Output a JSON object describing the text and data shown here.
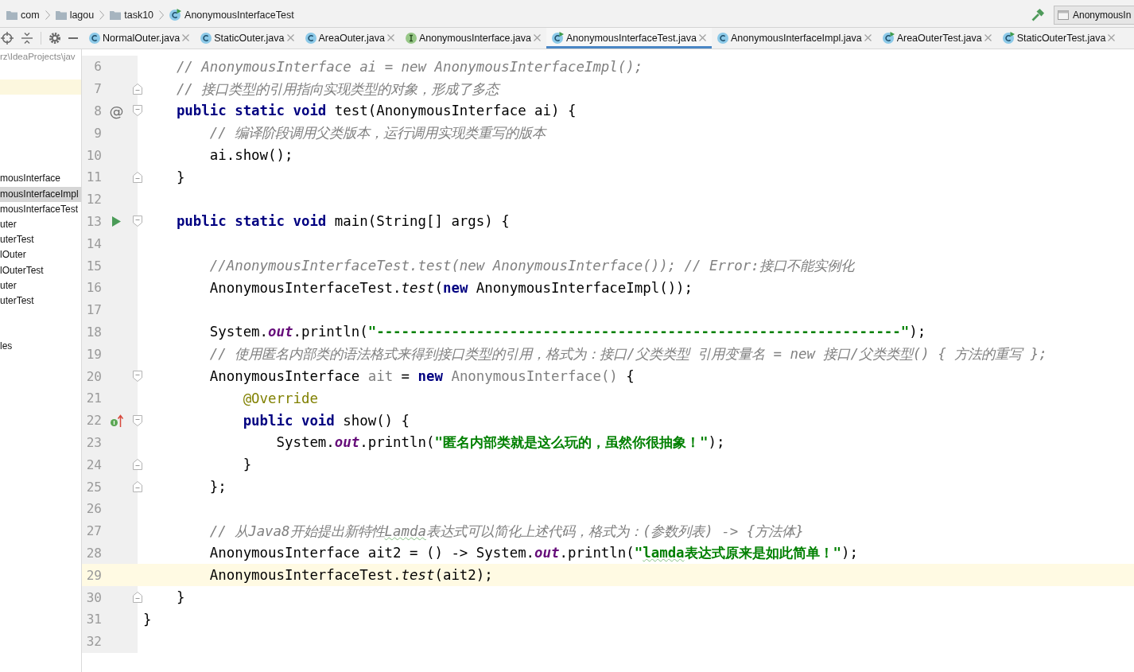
{
  "breadcrumbs": [
    {
      "label": "com",
      "kind": "folder"
    },
    {
      "label": "lagou",
      "kind": "folder"
    },
    {
      "label": "task10",
      "kind": "folder"
    },
    {
      "label": "AnonymousInterfaceTest",
      "kind": "runnable-class"
    }
  ],
  "run_config": {
    "label": "AnonymousIn"
  },
  "tabs": [
    {
      "label": "NormalOuter.java",
      "kind": "class",
      "selected": false
    },
    {
      "label": "StaticOuter.java",
      "kind": "class",
      "selected": false
    },
    {
      "label": "AreaOuter.java",
      "kind": "class",
      "selected": false
    },
    {
      "label": "AnonymousInterface.java",
      "kind": "interface",
      "selected": false
    },
    {
      "label": "AnonymousInterfaceTest.java",
      "kind": "runnable-class",
      "selected": true
    },
    {
      "label": "AnonymousInterfaceImpl.java",
      "kind": "class",
      "selected": false
    },
    {
      "label": "AreaOuterTest.java",
      "kind": "runnable-class",
      "selected": false
    },
    {
      "label": "StaticOuterTest.java",
      "kind": "runnable-class",
      "selected": false
    }
  ],
  "project_tree": {
    "path": "rz\\IdeaProjects\\jav",
    "items": [
      {
        "label": "mousInterface",
        "selected": false
      },
      {
        "label": "mousInterfaceImpl",
        "selected": true
      },
      {
        "label": "mousInterfaceTest",
        "selected": false
      },
      {
        "label": "uter",
        "selected": false
      },
      {
        "label": "uterTest",
        "selected": false
      },
      {
        "label": "lOuter",
        "selected": false
      },
      {
        "label": "lOuterTest",
        "selected": false
      },
      {
        "label": "uter",
        "selected": false
      },
      {
        "label": "uterTest",
        "selected": false
      },
      {
        "label": "les",
        "selected": false
      }
    ]
  },
  "editor": {
    "lines": [
      {
        "number": "6",
        "current": false,
        "tokens": [
          {
            "kind": "comment",
            "text": "    // AnonymousInterface ai = new AnonymousInterfaceImpl();"
          }
        ]
      },
      {
        "number": "7",
        "current": false,
        "fold": {
          "kind": "end"
        },
        "tokens": [
          {
            "kind": "comment",
            "text": "    // 接口类型的引用指向实现类型的对象，形成了多态"
          }
        ]
      },
      {
        "number": "8",
        "current": false,
        "fold": {
          "kind": "start"
        },
        "marker": {
          "kind": "symbol",
          "text": "@"
        },
        "tokens": [
          {
            "kind": "keyword",
            "text": "    public static void"
          },
          {
            "kind": "plain",
            "text": " test(AnonymousInterface ai) {"
          }
        ]
      },
      {
        "number": "9",
        "current": false,
        "tokens": [
          {
            "kind": "comment",
            "text": "        // 编译阶段调用父类版本，运行调用实现类重写的版本"
          }
        ]
      },
      {
        "number": "10",
        "current": false,
        "tokens": [
          {
            "kind": "plain",
            "text": "        ai.show();"
          }
        ]
      },
      {
        "number": "11",
        "current": false,
        "fold": {
          "kind": "end"
        },
        "tokens": [
          {
            "kind": "plain",
            "text": "    }"
          }
        ]
      },
      {
        "number": "12",
        "current": false
      },
      {
        "number": "13",
        "current": false,
        "fold": {
          "kind": "start"
        },
        "marker": {
          "kind": "run"
        },
        "tokens": [
          {
            "kind": "keyword",
            "text": "    public static void"
          },
          {
            "kind": "plain",
            "text": " main(String[] args) {"
          }
        ]
      },
      {
        "number": "14",
        "current": false
      },
      {
        "number": "15",
        "current": false,
        "tokens": [
          {
            "kind": "comment",
            "text": "        //AnonymousInterfaceTest.test(new AnonymousInterface()); // Error:接口不能实例化"
          }
        ]
      },
      {
        "number": "16",
        "current": false,
        "tokens": [
          {
            "kind": "plain",
            "text": "        AnonymousInterfaceTest."
          },
          {
            "kind": "static-call",
            "text": "test"
          },
          {
            "kind": "plain",
            "text": "("
          },
          {
            "kind": "keyword",
            "text": "new"
          },
          {
            "kind": "plain",
            "text": " AnonymousInterfaceImpl());"
          }
        ]
      },
      {
        "number": "17",
        "current": false
      },
      {
        "number": "18",
        "current": false,
        "tokens": [
          {
            "kind": "plain",
            "text": "        System."
          },
          {
            "kind": "static-field",
            "text": "out"
          },
          {
            "kind": "plain",
            "text": ".println("
          },
          {
            "kind": "string",
            "text": "\"---------------------------------------------------------------\""
          },
          {
            "kind": "plain",
            "text": ");"
          }
        ]
      },
      {
        "number": "19",
        "current": false,
        "tokens": [
          {
            "kind": "comment",
            "text": "        // 使用匿名内部类的语法格式来得到接口类型的引用，格式为：接口/父类类型 引用变量名 = new 接口/父类类型() { 方法的重写 };"
          }
        ]
      },
      {
        "number": "20",
        "current": false,
        "fold": {
          "kind": "start"
        },
        "tokens": [
          {
            "kind": "plain",
            "text": "        AnonymousInterface "
          },
          {
            "kind": "unused",
            "text": "ait"
          },
          {
            "kind": "plain",
            "text": " = "
          },
          {
            "kind": "keyword",
            "text": "new"
          },
          {
            "kind": "unused",
            "text": " AnonymousInterface()"
          },
          {
            "kind": "plain",
            "text": " {"
          }
        ]
      },
      {
        "number": "21",
        "current": false,
        "tokens": [
          {
            "kind": "annotation",
            "text": "            @Override"
          }
        ]
      },
      {
        "number": "22",
        "current": false,
        "fold": {
          "kind": "start"
        },
        "marker": {
          "kind": "implements"
        },
        "tokens": [
          {
            "kind": "keyword",
            "text": "            public void"
          },
          {
            "kind": "plain",
            "text": " show() {"
          }
        ]
      },
      {
        "number": "23",
        "current": false,
        "tokens": [
          {
            "kind": "plain",
            "text": "                System."
          },
          {
            "kind": "static-field",
            "text": "out"
          },
          {
            "kind": "plain",
            "text": ".println("
          },
          {
            "kind": "string",
            "text": "\"匿名内部类就是这么玩的，虽然你很抽象！\""
          },
          {
            "kind": "plain",
            "text": ");"
          }
        ]
      },
      {
        "number": "24",
        "current": false,
        "fold": {
          "kind": "end"
        },
        "tokens": [
          {
            "kind": "plain",
            "text": "            }"
          }
        ]
      },
      {
        "number": "25",
        "current": false,
        "fold": {
          "kind": "end"
        },
        "tokens": [
          {
            "kind": "plain",
            "text": "        };"
          }
        ]
      },
      {
        "number": "26",
        "current": false
      },
      {
        "number": "27",
        "current": false,
        "tokens": [
          {
            "kind": "comment",
            "text": "        // 从Java8开始提出新特性"
          },
          {
            "kind": "comment-misspelled",
            "text": "Lamda"
          },
          {
            "kind": "comment",
            "text": "表达式可以简化上述代码，格式为：(参数列表) -> {方法体}"
          }
        ]
      },
      {
        "number": "28",
        "current": false,
        "tokens": [
          {
            "kind": "plain",
            "text": "        AnonymousInterface ait2 = () -> System."
          },
          {
            "kind": "static-field",
            "text": "out"
          },
          {
            "kind": "plain",
            "text": ".println("
          },
          {
            "kind": "string",
            "text": "\""
          },
          {
            "kind": "string-misspelled",
            "text": "lamda"
          },
          {
            "kind": "string",
            "text": "表达式原来是如此简单！\""
          },
          {
            "kind": "plain",
            "text": ");"
          }
        ]
      },
      {
        "number": "29",
        "current": true,
        "tokens": [
          {
            "kind": "plain",
            "text": "        AnonymousInterfaceTest."
          },
          {
            "kind": "static-call",
            "text": "test"
          },
          {
            "kind": "plain",
            "text": "(ait2);"
          }
        ]
      },
      {
        "number": "30",
        "current": false,
        "fold": {
          "kind": "end"
        },
        "tokens": [
          {
            "kind": "plain",
            "text": "    }"
          }
        ]
      },
      {
        "number": "31",
        "current": false,
        "tokens": [
          {
            "kind": "plain",
            "text": "}"
          }
        ]
      },
      {
        "number": "32",
        "current": false
      }
    ]
  }
}
